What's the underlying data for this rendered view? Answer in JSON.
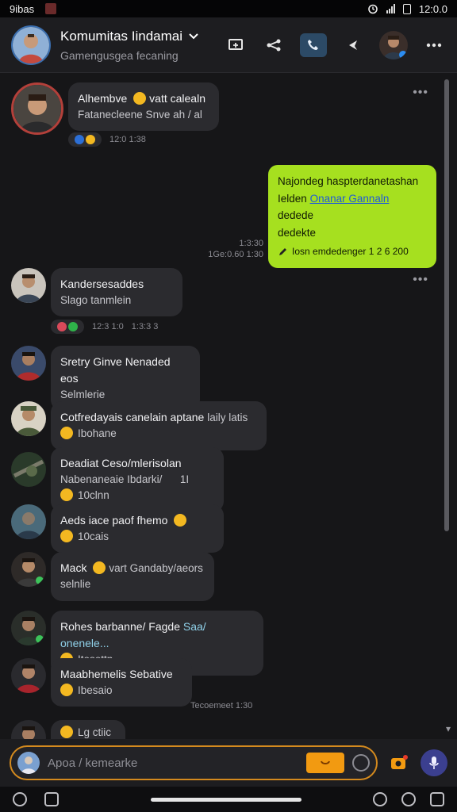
{
  "status_bar": {
    "left_text": "9ibas",
    "time": "12:0.0"
  },
  "header": {
    "title": "Komumitas Iindamai",
    "subtitle": "Gamengusgea fecaning"
  },
  "messages": [
    {
      "name": "Alhembve",
      "name_suffix": "vatt calealn",
      "line2": "Fatanecleene Snve ah / al",
      "time": "12:0 1:38"
    },
    {
      "name": "Kandersesaddes",
      "line2": "Slago tanmlein",
      "time": "12:3 1:0",
      "time2": "1:3:3 3"
    },
    {
      "name": "Sretry Ginve Nenaded",
      "name_suffix": "eos",
      "line2": "Selmlerie"
    },
    {
      "name": "Cotfredayais canelain aptane",
      "name_suffix": "laily latis",
      "line2": "Ibohane"
    },
    {
      "name": "Deadiat Ceso/mlerisolan",
      "line2": "Nabenaneaie Ibdarki/",
      "line2_suffix": "1I",
      "line3": "10clnn"
    },
    {
      "name": "Aeds iace paof fhemo",
      "line2": "10cais"
    },
    {
      "name": "Mack",
      "name_suffix": "vart Gandaby/aeors",
      "line2": "selnlie"
    },
    {
      "name": "Rohes barbanne/ Fagde",
      "name_link": "Saa/ onenele...",
      "line2": "Itosottn"
    },
    {
      "name": "Maabhemelis Sebative",
      "line2": "Ibesaio",
      "time": "Tecoemeet 1:30"
    },
    {
      "line2": "Lg ctiic"
    }
  ],
  "sent": {
    "line1": "Najondeg haspterdanetashan",
    "line2_pre": "Ielden",
    "line2_link": "Onanar Gannaln",
    "line3": "dedede",
    "line4": "dedekte",
    "footer": "Iosn emdedenger 1 2 6 200",
    "time_top": "1:3:30",
    "time_bottom": "1Ge:0.60 1:30"
  },
  "composer": {
    "placeholder": "Apoa / kemearke"
  },
  "colors": {
    "accent_green": "#a6e01f",
    "accent_orange": "#f29a11",
    "header_bg": "#1d1d20"
  }
}
